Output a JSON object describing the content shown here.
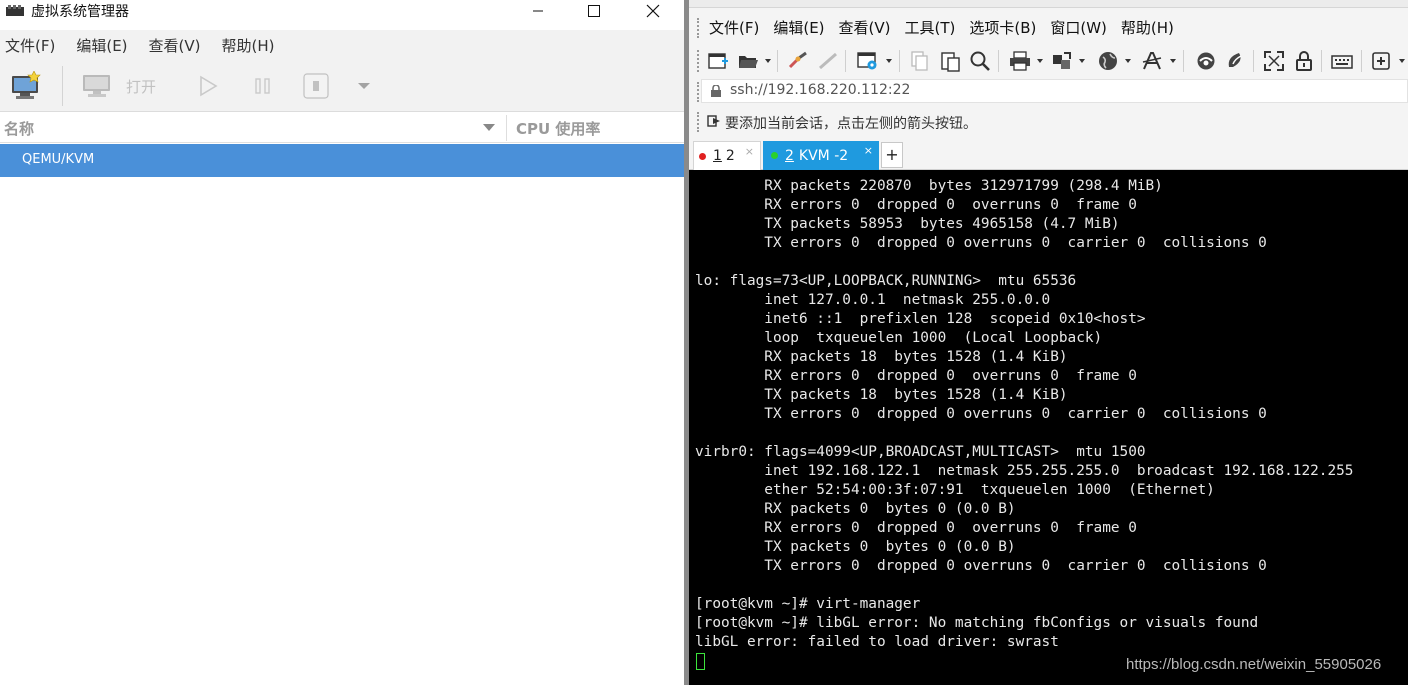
{
  "virt_manager": {
    "title": "虚拟系统管理器",
    "menu": [
      {
        "label": "文件(F)",
        "key": "F"
      },
      {
        "label": "编辑(E)",
        "key": "E"
      },
      {
        "label": "查看(V)",
        "key": "V"
      },
      {
        "label": "帮助(H)",
        "key": "H"
      }
    ],
    "toolbar": {
      "open_label": "打开"
    },
    "columns": {
      "name": "名称",
      "cpu": "CPU 使用率"
    },
    "connection": "QEMU/KVM",
    "icons": [
      "new-vm-icon",
      "monitor-icon",
      "play-icon",
      "pause-icon",
      "stop-icon",
      "dropdown-arrow-icon"
    ]
  },
  "xshell": {
    "menu": [
      "文件(F)",
      "编辑(E)",
      "查看(V)",
      "工具(T)",
      "选项卡(B)",
      "窗口(W)",
      "帮助(H)"
    ],
    "address": "ssh://192.168.220.112:22",
    "tip": "要添加当前会话，点击左侧的箭头按钮。",
    "tabs": [
      {
        "num": "1",
        "label": "2",
        "status_color": "#e02020",
        "active": false
      },
      {
        "num": "2",
        "label": "KVM -2",
        "status_color": "#2bd12b",
        "active": true
      }
    ],
    "accent": "#1f9adf",
    "terminal_lines": [
      "        RX packets 220870  bytes 312971799 (298.4 MiB)",
      "        RX errors 0  dropped 0  overruns 0  frame 0",
      "        TX packets 58953  bytes 4965158 (4.7 MiB)",
      "        TX errors 0  dropped 0 overruns 0  carrier 0  collisions 0",
      "",
      "lo: flags=73<UP,LOOPBACK,RUNNING>  mtu 65536",
      "        inet 127.0.0.1  netmask 255.0.0.0",
      "        inet6 ::1  prefixlen 128  scopeid 0x10<host>",
      "        loop  txqueuelen 1000  (Local Loopback)",
      "        RX packets 18  bytes 1528 (1.4 KiB)",
      "        RX errors 0  dropped 0  overruns 0  frame 0",
      "        TX packets 18  bytes 1528 (1.4 KiB)",
      "        TX errors 0  dropped 0 overruns 0  carrier 0  collisions 0",
      "",
      "virbr0: flags=4099<UP,BROADCAST,MULTICAST>  mtu 1500",
      "        inet 192.168.122.1  netmask 255.255.255.0  broadcast 192.168.122.255",
      "        ether 52:54:00:3f:07:91  txqueuelen 1000  (Ethernet)",
      "        RX packets 0  bytes 0 (0.0 B)",
      "        RX errors 0  dropped 0  overruns 0  frame 0",
      "        TX packets 0  bytes 0 (0.0 B)",
      "        TX errors 0  dropped 0 overruns 0  carrier 0  collisions 0",
      "",
      "[root@kvm ~]# virt-manager",
      "[root@kvm ~]# libGL error: No matching fbConfigs or visuals found",
      "libGL error: failed to load driver: swrast"
    ],
    "watermark": "https://blog.csdn.net/weixin_55905026"
  }
}
